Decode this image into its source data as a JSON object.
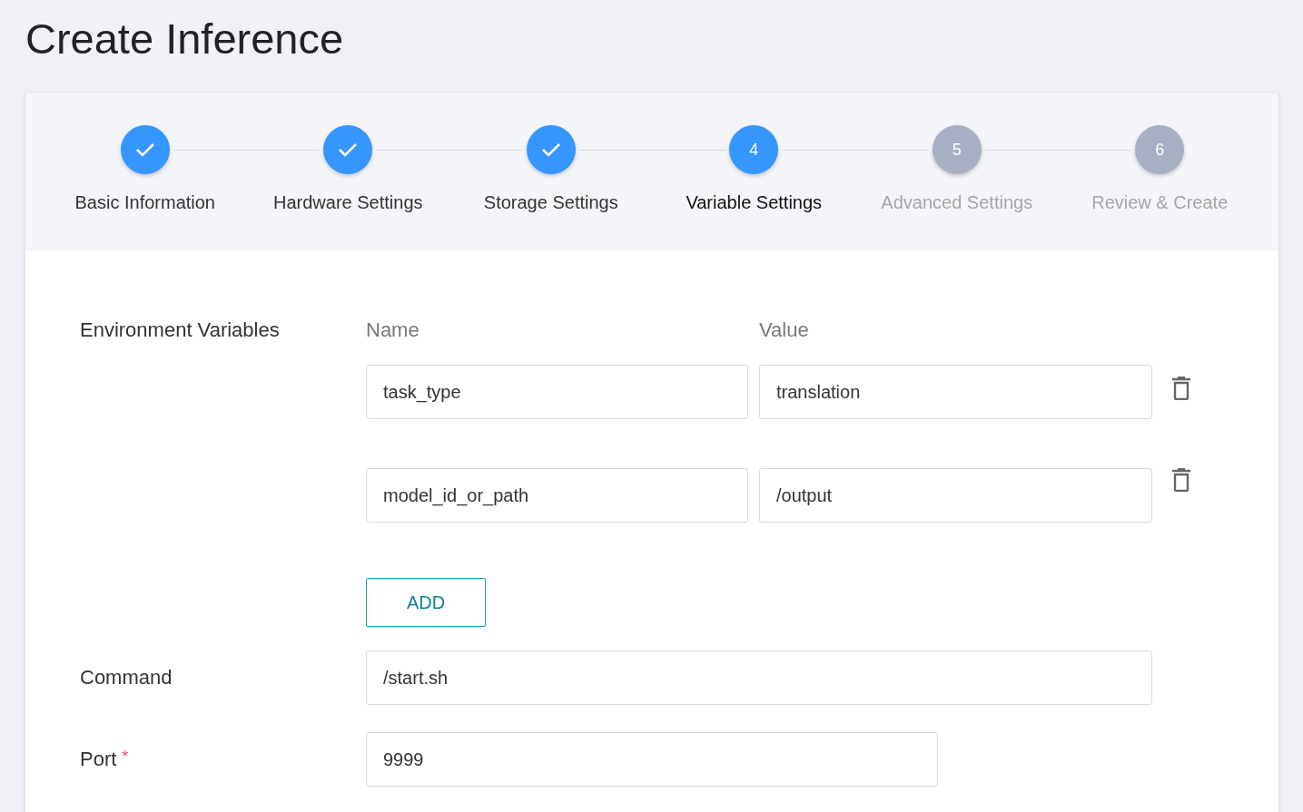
{
  "page": {
    "title": "Create Inference"
  },
  "steps": [
    {
      "label": "Basic Information",
      "completed": true,
      "selected": false
    },
    {
      "label": "Hardware Settings",
      "completed": true,
      "selected": false
    },
    {
      "label": "Storage Settings",
      "completed": true,
      "selected": false
    },
    {
      "label": "Variable Settings",
      "number": "4",
      "completed": false,
      "selected": true
    },
    {
      "label": "Advanced Settings",
      "number": "5",
      "completed": false,
      "selected": false
    },
    {
      "label": "Review & Create",
      "number": "6",
      "completed": false,
      "selected": false
    }
  ],
  "environment_variables": {
    "label": "Environment Variables",
    "name_header": "Name",
    "value_header": "Value",
    "rows": [
      {
        "name": "task_type",
        "value": "translation"
      },
      {
        "name": "model_id_or_path",
        "value": "/output"
      }
    ],
    "add_button": "ADD"
  },
  "command": {
    "label": "Command",
    "value": "/start.sh"
  },
  "port": {
    "label": "Port",
    "required_mark": "*",
    "value": "9999"
  }
}
